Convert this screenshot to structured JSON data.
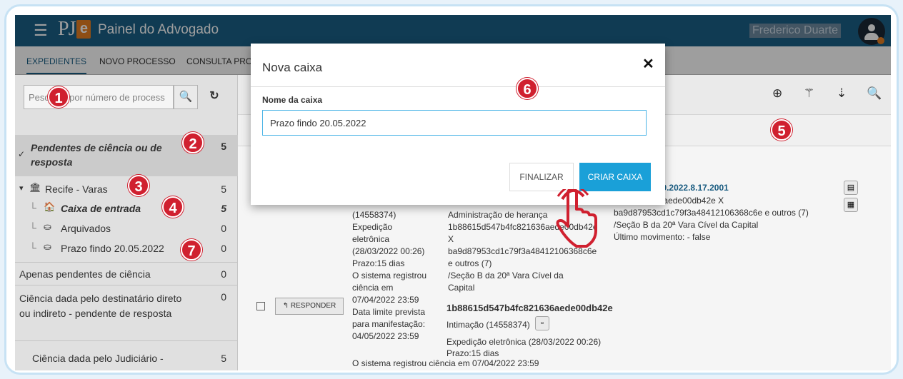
{
  "header": {
    "app_title": "Painel do Advogado",
    "user_name": "Frederico Duarte"
  },
  "tabs": [
    {
      "label": "EXPEDIENTES"
    },
    {
      "label": "NOVO PROCESSO"
    },
    {
      "label": "CONSULTA PRO"
    }
  ],
  "sidebar": {
    "search_placeholder": "Pesquise por número de process",
    "items": [
      {
        "label": "Pendentes de ciência ou de resposta",
        "count": "5"
      },
      {
        "label": "Recife - Varas",
        "count": "5"
      },
      {
        "label": "Caixa de entrada",
        "count": "5"
      },
      {
        "label": "Arquivados",
        "count": "0"
      },
      {
        "label": "Prazo findo 20.05.2022",
        "count": "0"
      },
      {
        "label": "Apenas pendentes de ciência",
        "count": "0"
      },
      {
        "label": "Ciência dada pelo destinatário direto ou indireto - pendente de resposta",
        "count": "0"
      },
      {
        "label": "Ciência dada pelo Judiciário -",
        "count": "5"
      }
    ]
  },
  "main": {
    "process_link": "v 0026356-29.2022.8.17.2001",
    "right_lines": [
      "7b4fc821636aede00db42e X",
      "ba9d87953cd1c79f3a48412106368c6e e outros (7)",
      "/Seção B da 20ª Vara Cível da Capital",
      "Último movimento: - false"
    ],
    "col1_lines": [
      "(14558374)",
      "Expedição",
      "eletrônica",
      "(28/03/2022 00:26)",
      "Prazo:15 dias",
      "O sistema registrou",
      "ciência em",
      "07/04/2022 23:59",
      "Data limite prevista",
      "para manifestação:",
      "04/05/2022 23:59"
    ],
    "col2_lines": [
      "Administração de herança",
      "1b88615d547b4fc821636aede00db42e",
      "X",
      "ba9d87953cd1c79f3a48412106368c6e",
      "e outros (7)",
      "/Seção B da 20ª Vara Cível da",
      "Capital"
    ],
    "respond_label": "RESPONDER",
    "hash": "1b88615d547b4fc821636aede00db42e",
    "intimacao": "Intimação (14558374)",
    "expedicao": "Expedição eletrônica (28/03/2022 00:26)",
    "prazo": "Prazo:15 dias",
    "registro": "O sistema registrou ciência em 07/04/2022 23:59"
  },
  "modal": {
    "title": "Nova caixa",
    "close": "✕",
    "field_label": "Nome da caixa",
    "field_value": "Prazo findo 20.05.2022",
    "finalize_label": "FINALIZAR",
    "create_label": "CRIAR CAIXA"
  },
  "steps": [
    "1",
    "2",
    "3",
    "4",
    "5",
    "6",
    "7"
  ],
  "colors": {
    "header": "#1a5f86",
    "accent_button": "#1aa0d8",
    "step_badge": "#d0202f",
    "hand": "#d0202f"
  }
}
